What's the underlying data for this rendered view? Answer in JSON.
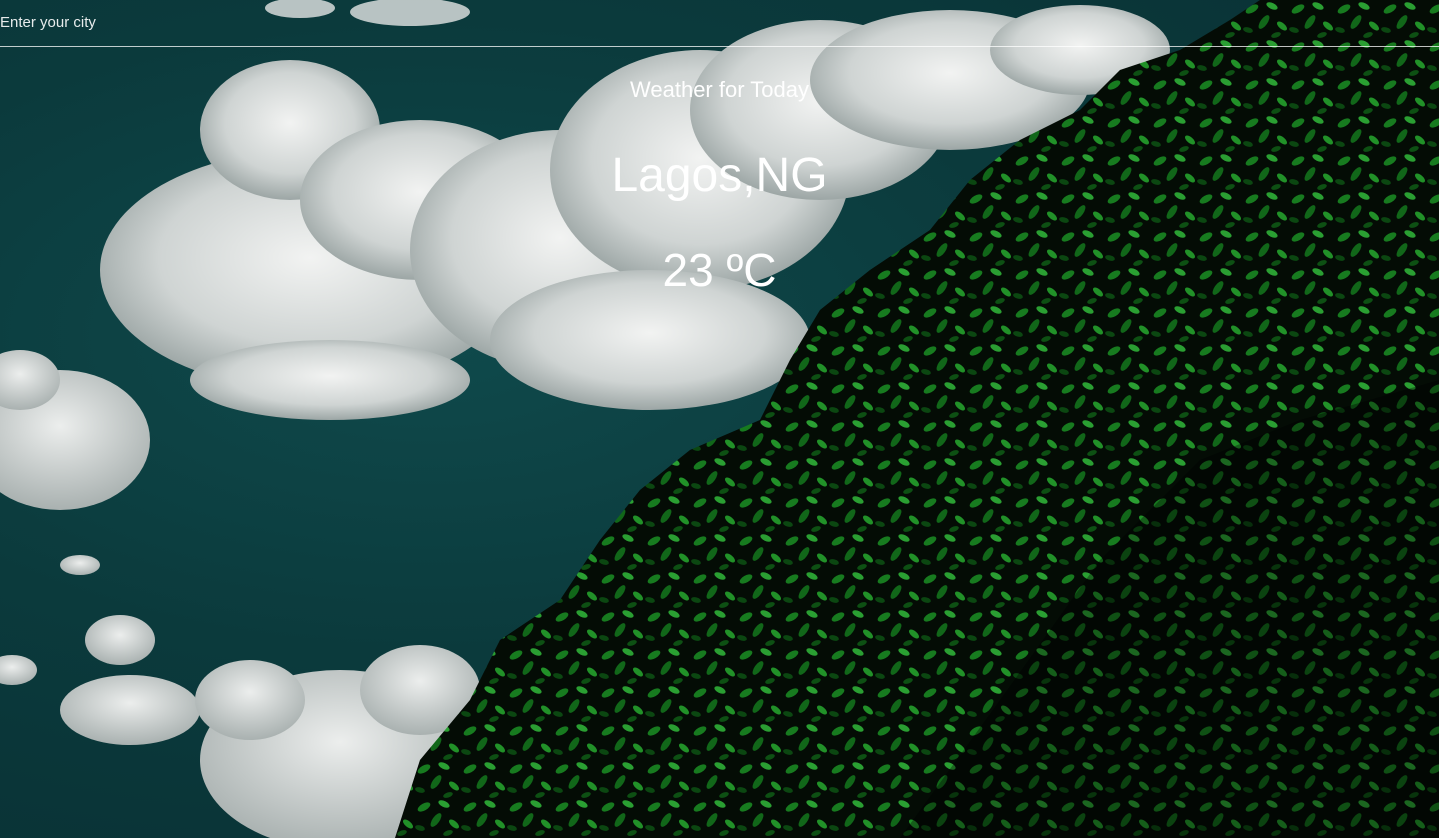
{
  "search": {
    "placeholder": "Enter your city",
    "value": ""
  },
  "weather": {
    "heading": "Weather for Today",
    "location": "Lagos,NG",
    "temperature": "23 ºC"
  },
  "colors": {
    "sky": "#0b3a3c",
    "cloud": "#e8ebea",
    "foliage_dark": "#0a1a0c",
    "foliage_bright": "#2fd13a",
    "text": "#ffffff"
  }
}
